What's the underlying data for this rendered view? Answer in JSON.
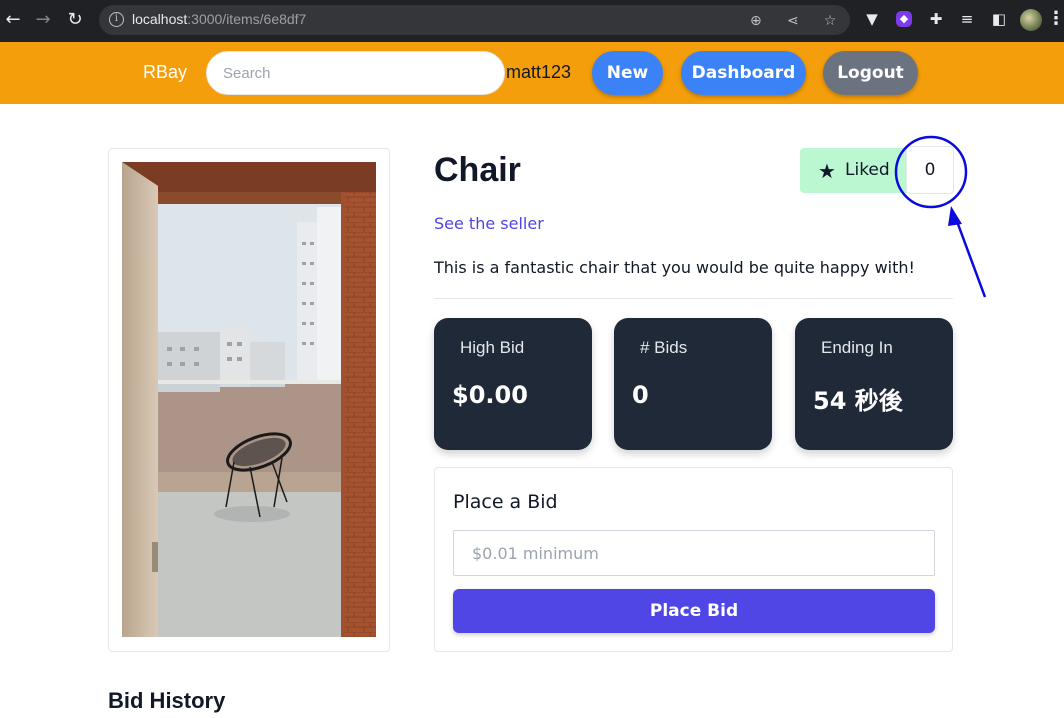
{
  "browser": {
    "url_host": "localhost",
    "url_path": ":3000/items/6e8df7",
    "icons": [
      "back-icon",
      "forward-icon",
      "reload-icon",
      "zoom-icon",
      "share-icon",
      "bookmark-star-icon"
    ],
    "extensions": [
      "vpn-extension-icon",
      "purple-extension-icon",
      "puzzle-extensions-icon",
      "media-controls-icon",
      "side-panel-icon",
      "profile-avatar",
      "more-menu-icon"
    ]
  },
  "header": {
    "brand": "RBay",
    "search_placeholder": "Search",
    "username": "matt123",
    "buttons": {
      "new": "New",
      "dashboard": "Dashboard",
      "logout": "Logout"
    },
    "colors": {
      "bar": "#f59e0b",
      "primary": "#3b82f6",
      "secondary": "#6b7280"
    }
  },
  "item": {
    "title": "Chair",
    "liked_label": "Liked",
    "like_count": "0",
    "seller_link": "See the seller",
    "description": "This is a fantastic chair that you would be quite happy with!",
    "image_alt": "photo-of-chair-on-balcony"
  },
  "stats": [
    {
      "label": "High Bid",
      "value": "$0.00"
    },
    {
      "label": "# Bids",
      "value": "0"
    },
    {
      "label": "Ending In",
      "value": "54 秒後"
    }
  ],
  "bid": {
    "title": "Place a Bid",
    "placeholder": "$0.01 minimum",
    "button": "Place Bid",
    "color": "#4f46e5"
  },
  "history": {
    "title": "Bid History"
  }
}
